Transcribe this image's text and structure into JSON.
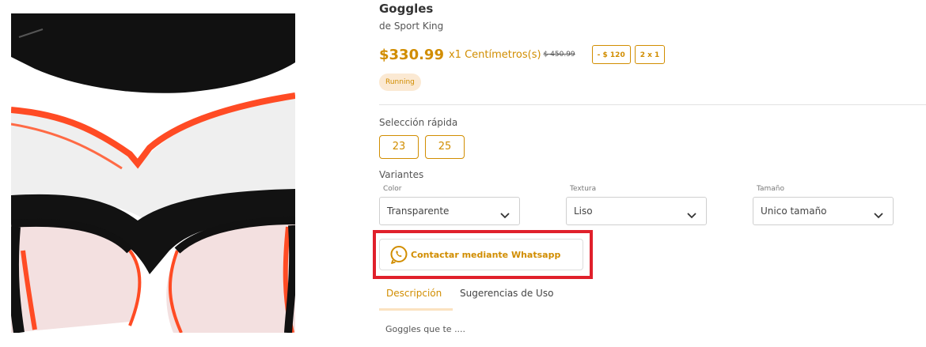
{
  "product": {
    "title": "Goggles",
    "brand": "de  Sport King",
    "price": "$330.99",
    "unit": "x1 Centímetros(s)",
    "old_price": "$ 450.99",
    "badges": [
      "- $ 120",
      "2 x 1"
    ],
    "tag": "Running"
  },
  "quick_selection": {
    "label": "Selección rápida",
    "options": [
      "23",
      "25"
    ]
  },
  "variants": {
    "label": "Variantes",
    "selects": [
      {
        "label": "Color",
        "value": "Transparente"
      },
      {
        "label": "Textura",
        "value": "Liso"
      },
      {
        "label": "Tamaño",
        "value": "Unico tamaño"
      }
    ]
  },
  "contact": {
    "button_label": "Contactar mediante Whatsapp",
    "icon": "whatsapp-icon"
  },
  "tabs": [
    {
      "label": "Descripción",
      "active": true
    },
    {
      "label": "Sugerencias de Uso",
      "active": false
    }
  ],
  "description": "Goggles que te ....",
  "colors": {
    "accent": "#d18d00",
    "highlight": "#e0202b",
    "tag_bg": "#fbe9d3"
  }
}
